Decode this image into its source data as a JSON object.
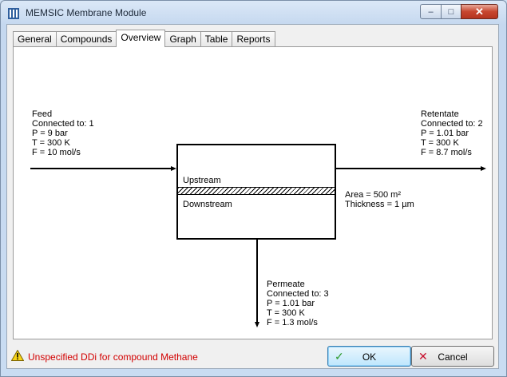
{
  "window": {
    "title": "MEMSIC Membrane Module",
    "controls": {
      "minimize": "–",
      "maximize": "□",
      "close": "✕"
    }
  },
  "tabs": [
    {
      "label": "General"
    },
    {
      "label": "Compounds"
    },
    {
      "label": "Overview",
      "active": true
    },
    {
      "label": "Graph"
    },
    {
      "label": "Table"
    },
    {
      "label": "Reports"
    }
  ],
  "diagram": {
    "feed": {
      "name": "Feed",
      "connected": "Connected to: 1",
      "p": "P = 9 bar",
      "t": "T = 300 K",
      "f": "F = 10 mol/s"
    },
    "retentate": {
      "name": "Retentate",
      "connected": "Connected to: 2",
      "p": "P = 1.01 bar",
      "t": "T = 300 K",
      "f": "F = 8.7 mol/s"
    },
    "permeate": {
      "name": "Permeate",
      "connected": "Connected to: 3",
      "p": "P = 1.01 bar",
      "t": "T = 300 K",
      "f": "F = 1.3 mol/s"
    },
    "module": {
      "upstream": "Upstream",
      "downstream": "Downstream"
    },
    "specs": {
      "area": "Area = 500 m²",
      "thickness": "Thickness = 1 µm"
    }
  },
  "status": {
    "warning": "Unspecified DDi for compound Methane",
    "warning_color": "#d20000"
  },
  "buttons": {
    "ok": {
      "label": "OK",
      "icon": "checkmark-icon",
      "icon_color": "#2e9a2e"
    },
    "cancel": {
      "label": "Cancel",
      "icon": "x-icon",
      "icon_color": "#c8102e"
    }
  }
}
